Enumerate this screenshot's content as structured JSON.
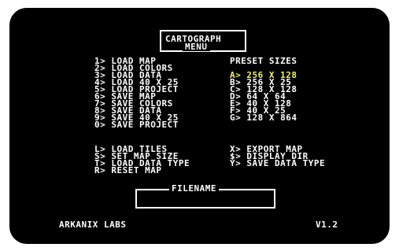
{
  "title": {
    "app": "CARTOGRAPH",
    "menu": "MENU"
  },
  "menu": [
    "1> LOAD MAP",
    "2> LOAD COLORS",
    "3> LOAD DATA",
    "4> LOAD 40 X 25",
    "5> LOAD PROJECT",
    "6> SAVE MAP",
    "7> SAVE COLORS",
    "8> SAVE DATA",
    "9> SAVE 40 X 25",
    "0> SAVE PROJECT"
  ],
  "presets": {
    "heading": "PRESET SIZES",
    "items": [
      "A> 256 X 128",
      "B> 256 X 25",
      "C> 128 X 128",
      "D> 64 X 64",
      "E> 40 X 128",
      "F> 40 X 25",
      "G> 128 X 864"
    ],
    "selected_color": "#f0f07a"
  },
  "commands_left": [
    "L> LOAD TILES",
    "S> SET MAP SIZE",
    "T> LOAD DATA TYPE",
    "R> RESET MAP"
  ],
  "commands_right": [
    "X> EXPORT MAP",
    "$> DISPLAY DIR",
    "Y> SAVE DATA TYPE"
  ],
  "filename": {
    "label": "FILENAME",
    "value": ""
  },
  "footer": {
    "publisher": "ARKANIX LABS",
    "version": "V1.2"
  },
  "colors": {
    "background": "#000000",
    "text": "#ffffff",
    "highlight": "#f0f07a"
  }
}
